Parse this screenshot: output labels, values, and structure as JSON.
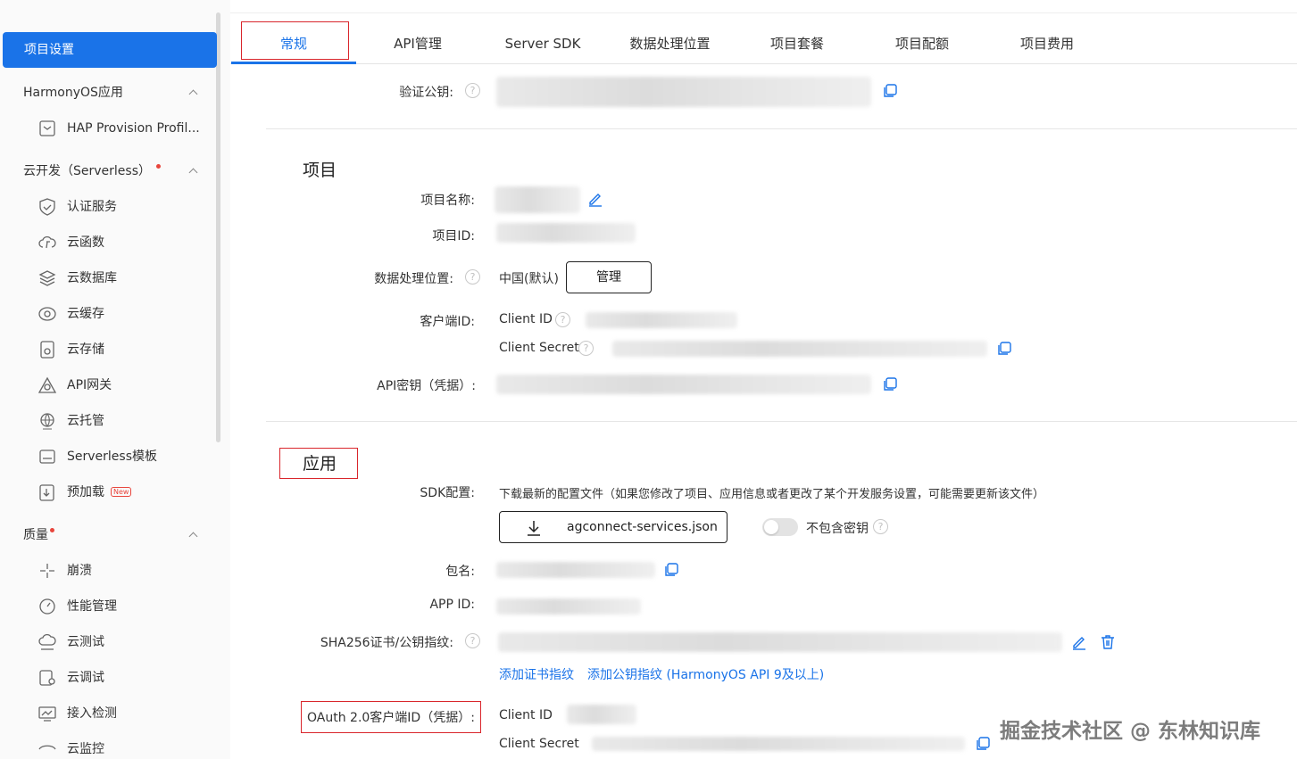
{
  "sidebar": {
    "active_item": "项目设置",
    "groups": [
      {
        "label": "HarmonyOS应用",
        "items": [
          {
            "label": "HAP Provision Profil...",
            "icon": "file-icon"
          }
        ]
      },
      {
        "label": "云开发（Serverless）",
        "items": [
          {
            "label": "认证服务",
            "icon": "shield-check-icon"
          },
          {
            "label": "云函数",
            "icon": "cloud-function-icon"
          },
          {
            "label": "云数据库",
            "icon": "database-icon"
          },
          {
            "label": "云缓存",
            "icon": "cache-icon"
          },
          {
            "label": "云存储",
            "icon": "storage-icon"
          },
          {
            "label": "API网关",
            "icon": "gateway-icon"
          },
          {
            "label": "云托管",
            "icon": "globe-icon"
          },
          {
            "label": "Serverless模板",
            "icon": "template-icon"
          },
          {
            "label": "预加载",
            "icon": "preload-icon",
            "badge": "New"
          }
        ]
      },
      {
        "label": "质量",
        "items": [
          {
            "label": "崩溃",
            "icon": "crash-icon"
          },
          {
            "label": "性能管理",
            "icon": "gauge-icon"
          },
          {
            "label": "云测试",
            "icon": "cloud-test-icon"
          },
          {
            "label": "云调试",
            "icon": "cloud-debug-icon"
          },
          {
            "label": "接入检测",
            "icon": "monitor-icon"
          },
          {
            "label": "云监控",
            "icon": "eye-icon"
          }
        ]
      }
    ]
  },
  "tabs": [
    {
      "label": "常规"
    },
    {
      "label": "API管理"
    },
    {
      "label": "Server SDK"
    },
    {
      "label": "数据处理位置"
    },
    {
      "label": "项目套餐"
    },
    {
      "label": "项目配额"
    },
    {
      "label": "项目费用"
    }
  ],
  "general": {
    "verify_key_label": "验证公钥:",
    "project_section_title": "项目",
    "project_name_label": "项目名称:",
    "project_id_label": "项目ID:",
    "data_location_label": "数据处理位置:",
    "data_location_value": "中国(默认)",
    "manage_button": "管理",
    "client_id_label": "客户端ID:",
    "client_id_text": "Client ID",
    "client_secret_text": "Client Secret",
    "api_key_label": "API密钥（凭据）:",
    "app_section_title": "应用",
    "sdk_config_label": "SDK配置:",
    "sdk_config_desc": "下载最新的配置文件（如果您修改了项目、应用信息或者更改了某个开发服务设置，可能需要更新该文件）",
    "download_button": "agconnect-services.json",
    "exclude_key_label": "不包含密钥",
    "package_label": "包名:",
    "app_id_label": "APP ID:",
    "sha256_label": "SHA256证书/公钥指纹:",
    "add_cert_link": "添加证书指纹",
    "add_pubkey_link": "添加公钥指纹 (HarmonyOS API 9及以上)",
    "oauth_label": "OAuth 2.0客户端ID（凭据）:",
    "oauth_client_id": "Client ID",
    "oauth_client_secret": "Client Secret"
  },
  "watermark": "掘金技术社区 @ 东林知识库",
  "colors": {
    "accent": "#1a73e8",
    "highlight_box": "#d9262c"
  }
}
